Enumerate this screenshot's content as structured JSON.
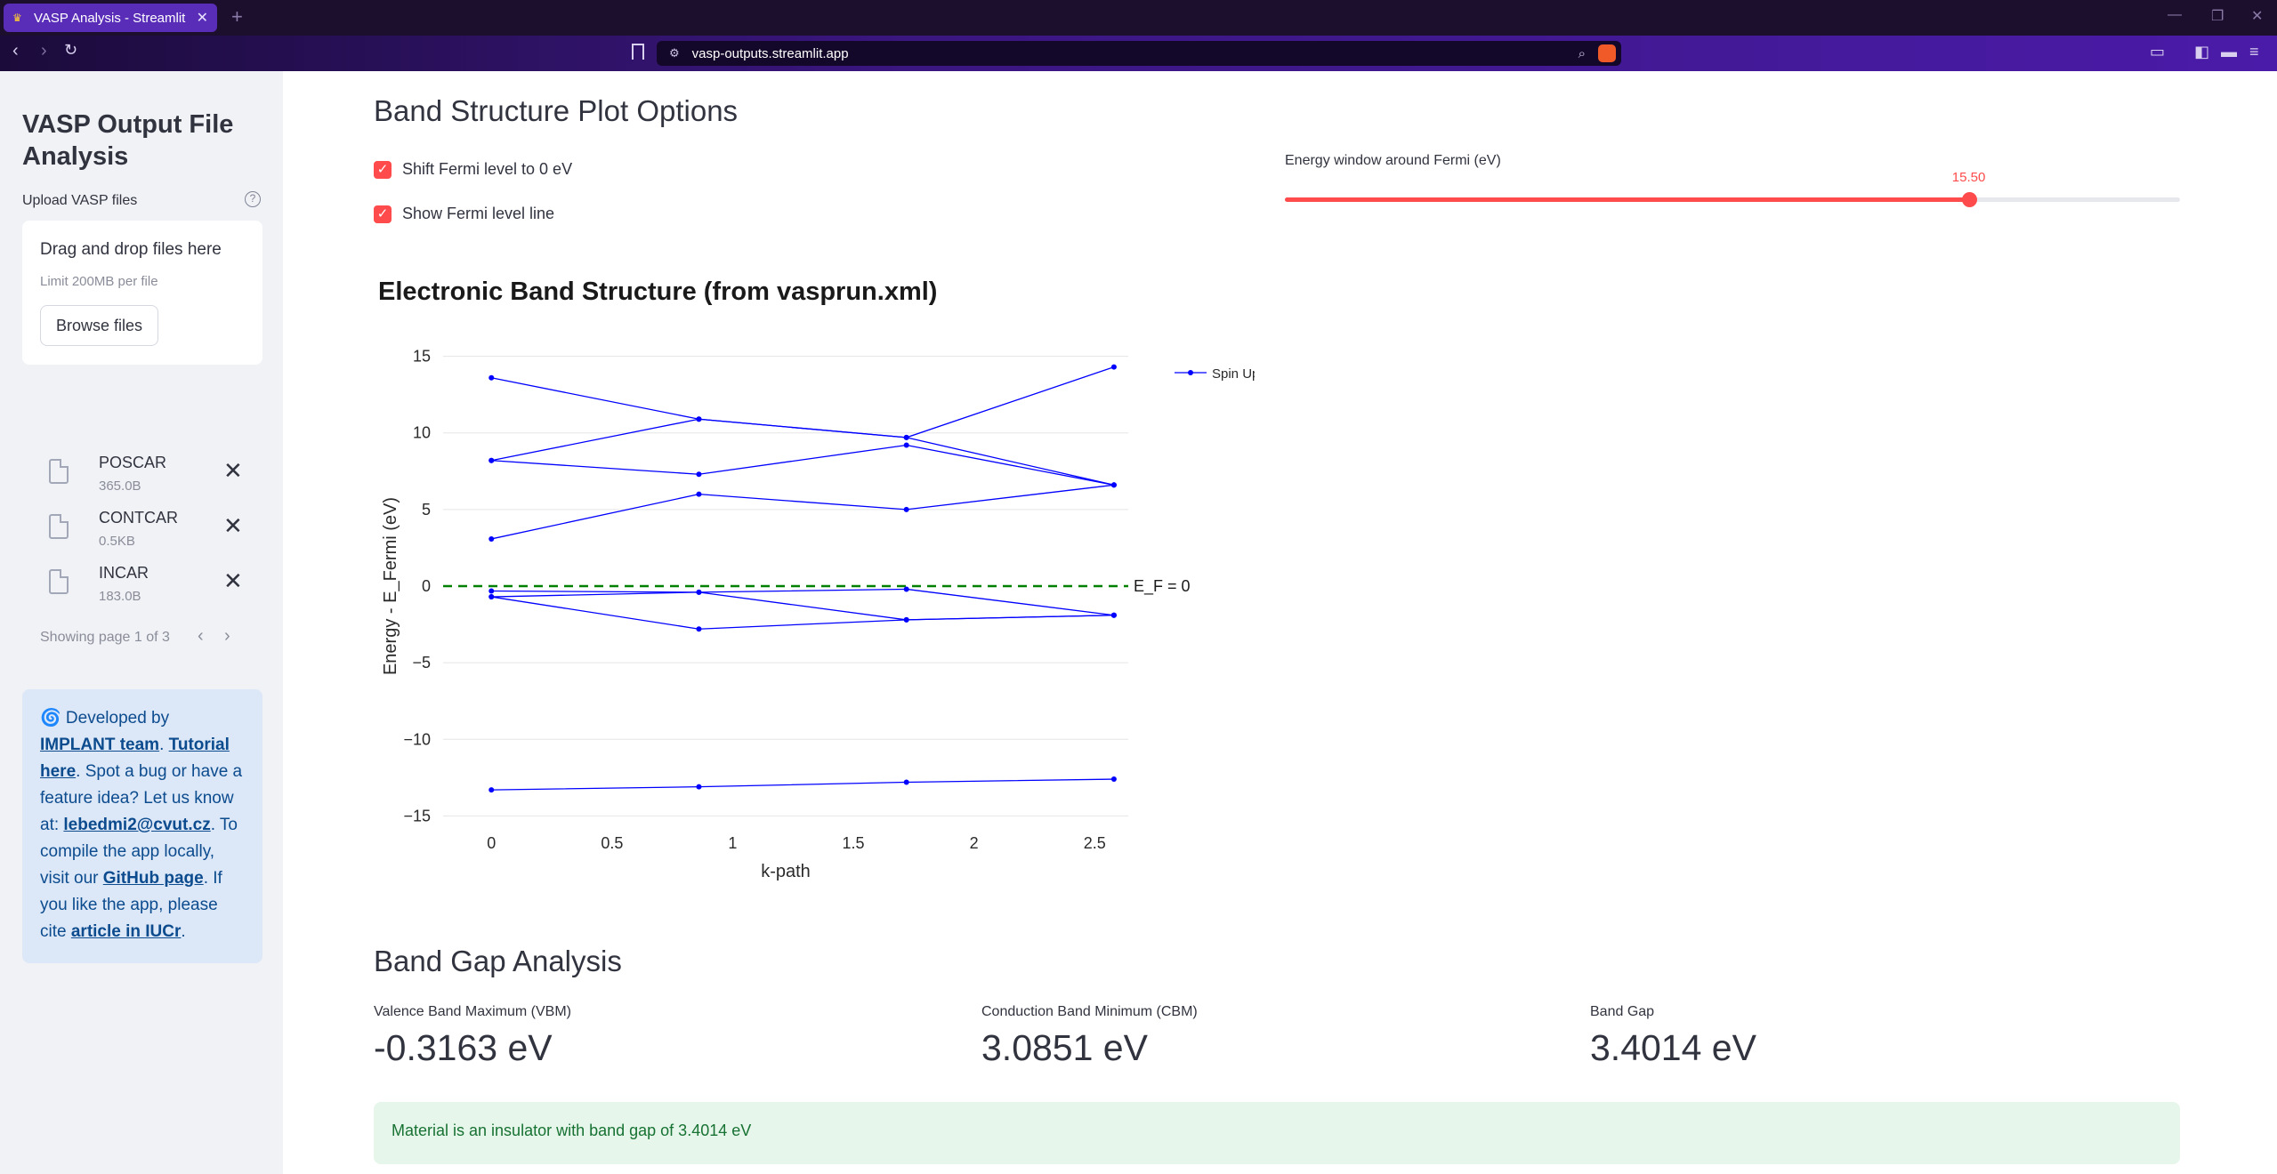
{
  "browser": {
    "tab_title": "VASP Analysis - Streamlit",
    "url": "vasp-outputs.streamlit.app"
  },
  "sidebar": {
    "title": "VASP Output File Analysis",
    "upload_label": "Upload VASP files",
    "dropzone_main": "Drag and drop files here",
    "dropzone_limit": "Limit 200MB per file",
    "browse_label": "Browse files",
    "files": [
      {
        "name": "POSCAR",
        "size": "365.0B"
      },
      {
        "name": "CONTCAR",
        "size": "0.5KB"
      },
      {
        "name": "INCAR",
        "size": "183.0B"
      }
    ],
    "pager_text": "Showing page 1 of 3",
    "info": {
      "prefix": "🌀 Developed by ",
      "link_team": "IMPLANT team",
      "sep1": ". ",
      "link_tutorial": "Tutorial here",
      "mid": ". Spot a bug or have a feature idea? Let us know at: ",
      "link_email": "lebedmi2@cvut.cz",
      "mid2": ". To compile the app locally, visit our ",
      "link_github": "GitHub page",
      "mid3": ". If you like the app, please cite ",
      "link_article": "article in IUCr",
      "end": "."
    }
  },
  "options": {
    "heading": "Band Structure Plot Options",
    "shift_fermi_label": "Shift Fermi level to 0 eV",
    "shift_fermi_checked": true,
    "show_fermi_label": "Show Fermi level line",
    "show_fermi_checked": true,
    "slider_label": "Energy window around Fermi (eV)",
    "slider_value": "15.50",
    "slider_fraction": 0.764
  },
  "chart_data": {
    "type": "line",
    "title": "Electronic Band Structure (from vasprun.xml)",
    "xlabel": "k-path",
    "ylabel": "Energy - E_Fermi (eV)",
    "xlim": [
      -0.2,
      2.75
    ],
    "ylim": [
      -15.5,
      15.5
    ],
    "xticks": [
      0,
      0.5,
      1,
      1.5,
      2,
      2.5
    ],
    "xtick_labels": [
      "0",
      "0.5",
      "1",
      "1.5",
      "2",
      "2.5"
    ],
    "yticks": [
      15,
      10,
      5,
      0,
      -5,
      -10,
      -15
    ],
    "ytick_labels": [
      "15",
      "10",
      "5",
      "0",
      "−5",
      "−10",
      "−15"
    ],
    "grid": "horizontal",
    "legend": "top-right",
    "x": [
      0,
      0.86,
      1.72,
      2.58
    ],
    "series": [
      {
        "name": "Spin Up",
        "color": "#0000ff",
        "bands": [
          [
            -13.3,
            -13.1,
            -12.8,
            -12.6
          ],
          [
            -0.7,
            -2.8,
            -2.2,
            -1.9
          ],
          [
            -0.7,
            -0.4,
            -2.2,
            -1.9
          ],
          [
            -0.32,
            -0.4,
            -0.2,
            -1.9
          ],
          [
            3.08,
            6.0,
            5.0,
            6.6
          ],
          [
            8.2,
            7.3,
            9.2,
            6.6
          ],
          [
            8.2,
            10.9,
            9.7,
            6.6
          ],
          [
            13.6,
            10.9,
            9.7,
            14.3
          ]
        ]
      }
    ],
    "fermi_line": {
      "y": 0,
      "label": "E_F = 0",
      "color": "#008000"
    }
  },
  "gap": {
    "heading": "Band Gap Analysis",
    "vbm_label": "Valence Band Maximum (VBM)",
    "vbm_value": "-0.3163 eV",
    "cbm_label": "Conduction Band Minimum (CBM)",
    "cbm_value": "3.0851 eV",
    "gap_label": "Band Gap",
    "gap_value": "3.4014 eV",
    "message": "Material is an insulator with band gap of 3.4014 eV"
  }
}
